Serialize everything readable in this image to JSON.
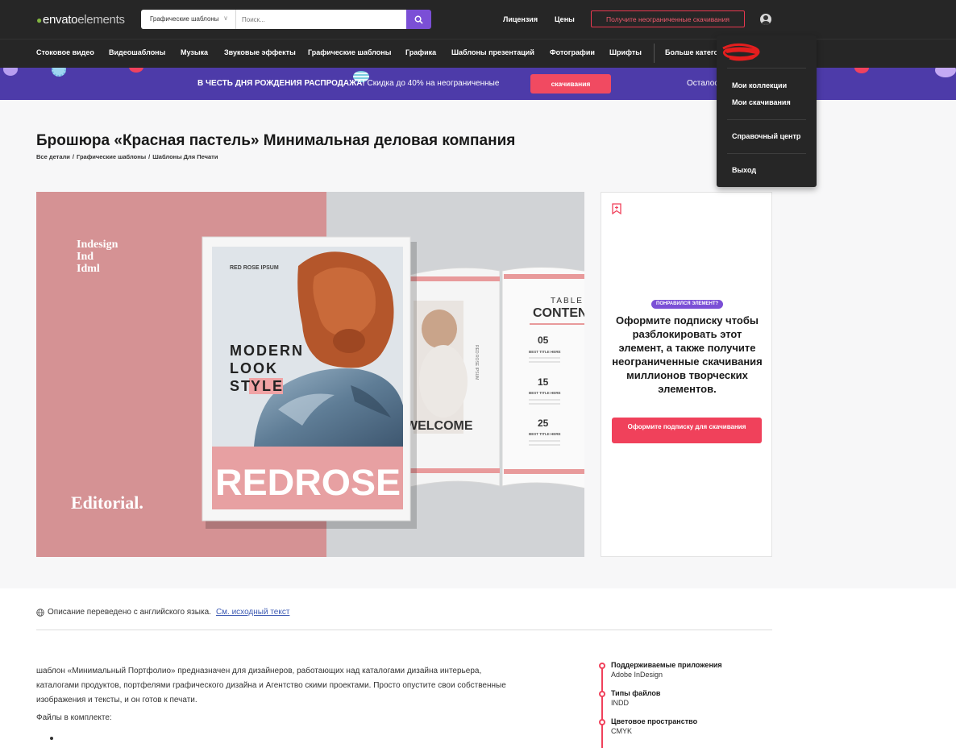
{
  "brand": {
    "logo_main": "envato",
    "logo_suffix": "elements",
    "accent": "#82b541"
  },
  "search": {
    "category": "Графические шаблоны",
    "placeholder": "Поиск..."
  },
  "top_nav": {
    "license": "Лицензия",
    "prices": "Цены",
    "cta": "Получите неограниченные скачивания"
  },
  "categories": [
    "Стоковое видео",
    "Видеошаблоны",
    "Музыка",
    "Звуковые эффекты",
    "Графические шаблоны",
    "Графика",
    "Шаблоны презентаций",
    "Фотографии",
    "Шрифты",
    "Больше катего"
  ],
  "promo": {
    "bold": "В ЧЕСТЬ ДНЯ РОЖДЕНИЯ РАСПРОДАЖА!",
    "text": " Скидка до 40% на неограниченные",
    "button": "скачивания",
    "remaining": "Осталос"
  },
  "user_menu": {
    "items": [
      "Мои коллекции",
      "Мои скачивания",
      "Справочный центр",
      "Выход"
    ]
  },
  "item": {
    "title": "Брошюра «Красная пастель» Минимальная деловая компания",
    "breadcrumb": [
      "Все детали",
      "Графические шаблоны",
      "Шаблоны Для Печати"
    ]
  },
  "preview": {
    "formats": [
      "Indesign",
      "Ind",
      "Idml"
    ],
    "editorial": "Editorial.",
    "cover_label": "RED ROSE IPSUM",
    "cover_line1": "MODERN",
    "cover_line2": "LOOK",
    "cover_line3a": "ST",
    "cover_line3b": "YLE",
    "cover_brand": "REDROSE",
    "spread_side": "RED ROSE IPSUM",
    "spread_welcome": "WELCOME",
    "toc_title_1": "TABLE OF",
    "toc_title_2": "CONTENTS",
    "toc_numbers": [
      "05",
      "15",
      "25"
    ],
    "toc_item": "BEST TITLE HERE"
  },
  "card": {
    "badge": "ПОНРАВИЛСЯ ЭЛЕМЕНТ?",
    "text": "Оформите подписку чтобы разблокировать этот элемент, а также получите неограниченные скачивания миллионов творческих элементов.",
    "button": "Оформите подписку для скачивания"
  },
  "description": {
    "translated_note": "Описание переведено с английского языка.",
    "original_link": "См. исходный текст",
    "body": "шаблон «Минимальный Портфолио» предназначен для дизайнеров, работающих над каталогами дизайна интерьера, каталогами продуктов, портфелями графического дизайна и Агентство скими проектами. Просто опустите свои собственные изображения и тексты, и он готов к печати.",
    "files_heading": "Файлы в комплекте:"
  },
  "attributes": [
    {
      "label": "Поддерживаемые приложения",
      "value": "Adobe InDesign"
    },
    {
      "label": "Типы файлов",
      "value": "INDD"
    },
    {
      "label": "Цветовое пространство",
      "value": "CMYK"
    }
  ],
  "colors": {
    "topbar": "#262626",
    "promo": "#4d3ba9",
    "accent_red": "#f0415b",
    "purple": "#7b4fd6"
  }
}
